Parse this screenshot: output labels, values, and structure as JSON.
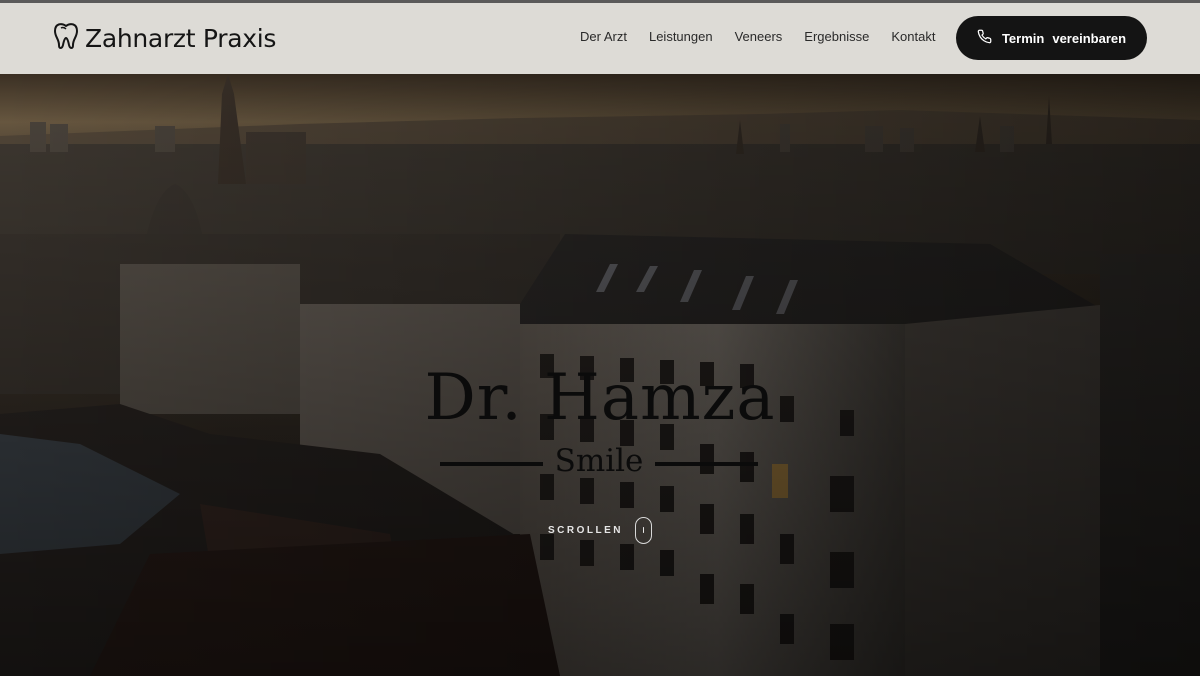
{
  "header": {
    "logo_text": "Zahnarzt Praxis",
    "nav": [
      "Der Arzt",
      "Leistungen",
      "Veneers",
      "Ergebnisse",
      "Kontakt"
    ],
    "cta_word1": "Termin",
    "cta_word2": "vereinbaren"
  },
  "hero": {
    "title": "Dr. Hamza",
    "subtitle": "Smile",
    "scroll_label": "SCROLLEN"
  },
  "icons": {
    "logo": "tooth-icon",
    "cta": "phone-icon",
    "scroll": "mouse-icon"
  },
  "colors": {
    "header_bg": "#dddbd6",
    "cta_bg": "#141414",
    "title": "#0b0b0b"
  }
}
